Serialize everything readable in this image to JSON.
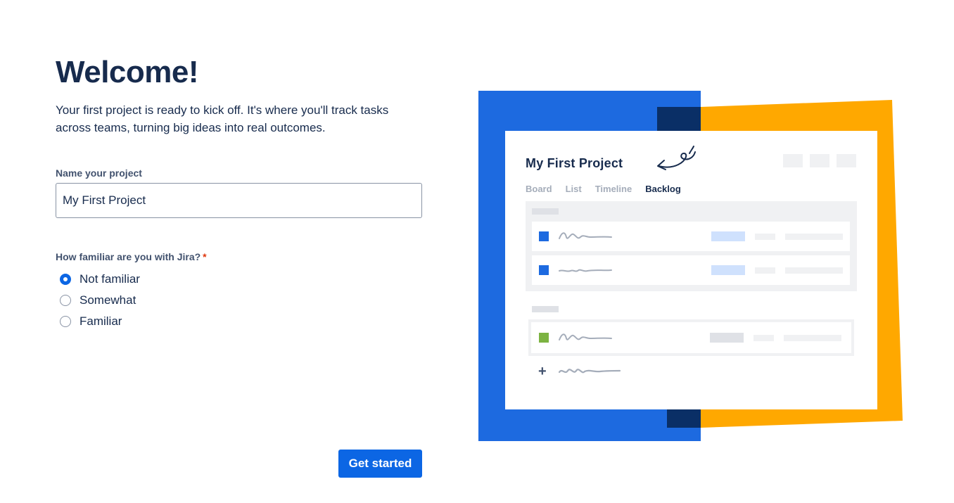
{
  "form": {
    "title": "Welcome!",
    "intro": "Your first project is ready to kick off. It's where you'll track tasks across teams, turning big ideas into real outcomes.",
    "name_label": "Name your project",
    "name_value": "My First Project",
    "familiar_label": "How familiar are you with Jira?",
    "required_mark": "*",
    "options": [
      {
        "label": "Not familiar",
        "checked": true
      },
      {
        "label": "Somewhat",
        "checked": false
      },
      {
        "label": "Familiar",
        "checked": false
      }
    ],
    "submit_label": "Get started"
  },
  "illustration": {
    "project_title": "My First Project",
    "tabs": [
      "Board",
      "List",
      "Timeline",
      "Backlog"
    ],
    "active_tab": "Backlog",
    "plus": "+",
    "colors": {
      "blue": "#1d6ae0",
      "navy": "#0a2f66",
      "orange": "#ffa800",
      "issue_blue": "#1d6ae0",
      "issue_green": "#7cb342",
      "pill_blue": "#cfe1fd",
      "pill_gray": "#dfe1e6"
    }
  },
  "colors": {
    "primary": "#0c66e4",
    "text": "#172b4d",
    "label": "#42526e",
    "required": "#de350b"
  }
}
